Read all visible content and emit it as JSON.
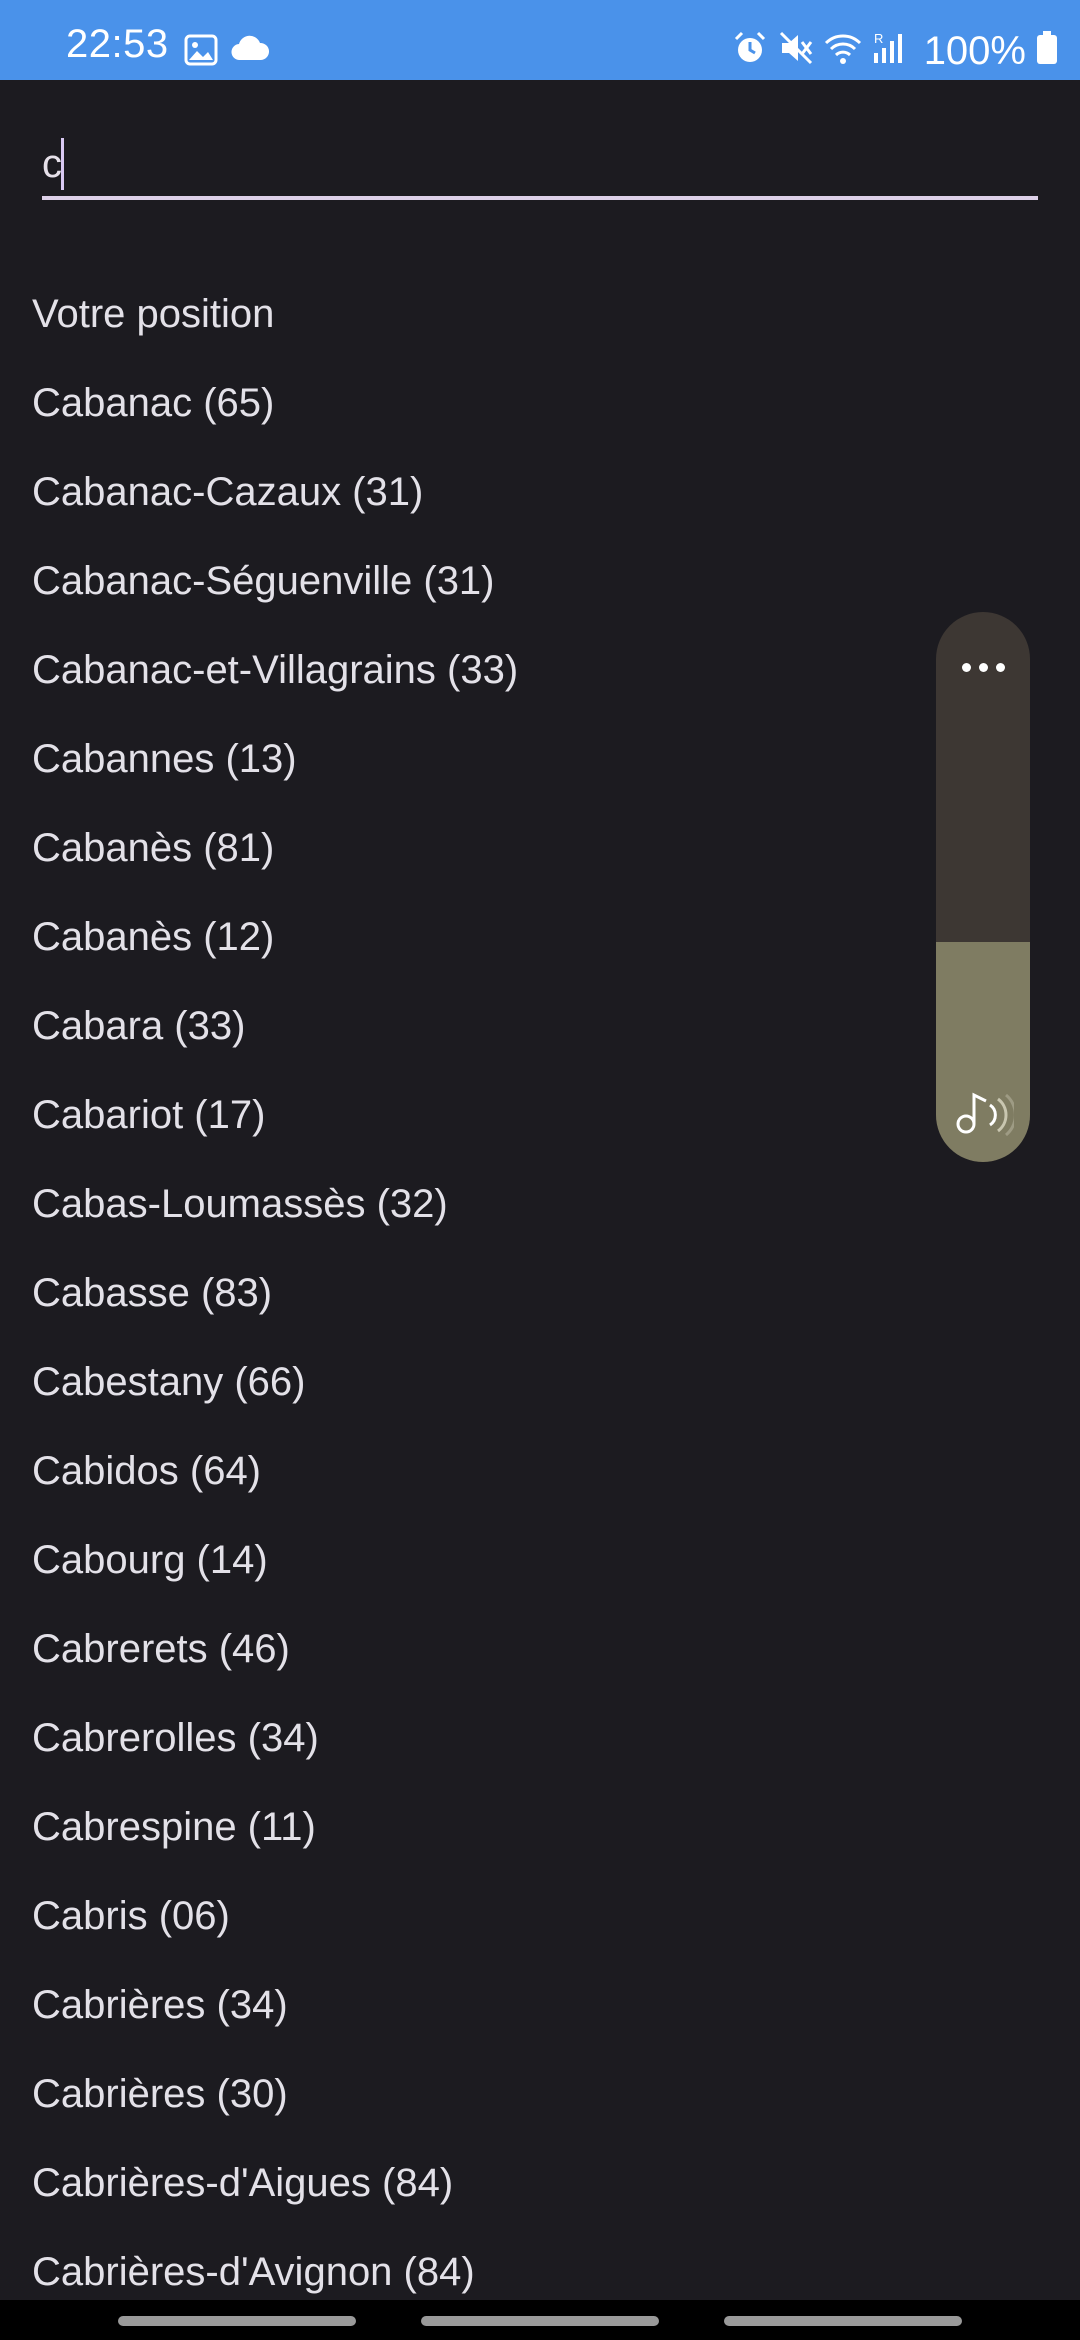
{
  "status_bar": {
    "time": "22:53",
    "battery": "100%",
    "left_icons": [
      "image-icon",
      "cloud-icon"
    ],
    "right_icons": [
      "alarm-icon",
      "mute-icon",
      "wifi-icon",
      "signal-icon",
      "battery-icon"
    ],
    "signal_roaming_label": "R",
    "background_color": "#4a92ea"
  },
  "search": {
    "value": "c"
  },
  "results": [
    "Votre position",
    "Cabanac (65)",
    "Cabanac-Cazaux (31)",
    "Cabanac-Séguenville (31)",
    "Cabanac-et-Villagrains (33)",
    "Cabannes (13)",
    "Cabanès (81)",
    "Cabanès (12)",
    "Cabara (33)",
    "Cabariot (17)",
    "Cabas-Loumassès (32)",
    "Cabasse (83)",
    "Cabestany (66)",
    "Cabidos (64)",
    "Cabourg (14)",
    "Cabrerets (46)",
    "Cabrerolles (34)",
    "Cabrespine (11)",
    "Cabris (06)",
    "Cabrières (34)",
    "Cabrières (30)",
    "Cabrières-d'Aigues (84)",
    "Cabrières-d'Avignon (84)"
  ],
  "volume_panel": {
    "level": 0.4,
    "more_icon": "more-dots-icon",
    "stream_icon": "music-note-icon"
  },
  "navigation": {
    "items": [
      "recents-pill",
      "home-pill",
      "back-pill"
    ]
  }
}
